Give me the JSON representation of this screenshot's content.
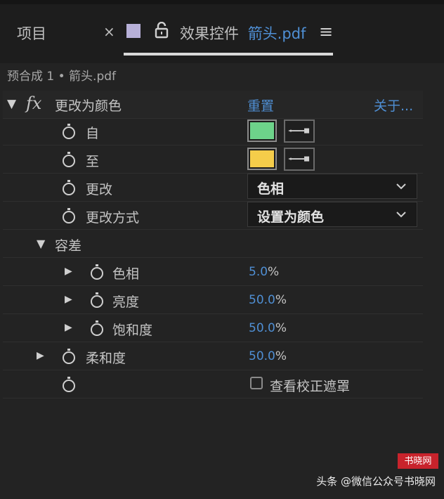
{
  "tabs": {
    "project_label": "项目",
    "close_symbol": "×",
    "effect_controls_label": "效果控件",
    "effect_controls_file": "箭头.pdf",
    "menu_symbol": "≡"
  },
  "subtitle": "预合成 1 • 箭头.pdf",
  "effect": {
    "fx_symbol": "fx",
    "name": "更改为颜色",
    "reset_label": "重置",
    "about_label": "关于...",
    "from_label": "自",
    "from_color": "#6dd38a",
    "to_label": "至",
    "to_color": "#f5cd4a",
    "change_label": "更改",
    "change_value": "色相",
    "change_by_label": "更改方式",
    "change_by_value": "设置为颜色",
    "tolerance_label": "容差",
    "hue_label": "色相",
    "hue_value": "5.0",
    "lightness_label": "亮度",
    "lightness_value": "50.0",
    "saturation_label": "饱和度",
    "saturation_value": "50.0",
    "softness_label": "柔和度",
    "softness_value": "50.0",
    "pct": "%",
    "view_correction_matte_label": "查看校正遮罩"
  },
  "watermark": {
    "text": "头条 @微信公众号书晓网",
    "logo_text": "书晓网"
  },
  "colors": {
    "accent_blue": "#4f8fd4",
    "panel_bg": "#232323"
  }
}
